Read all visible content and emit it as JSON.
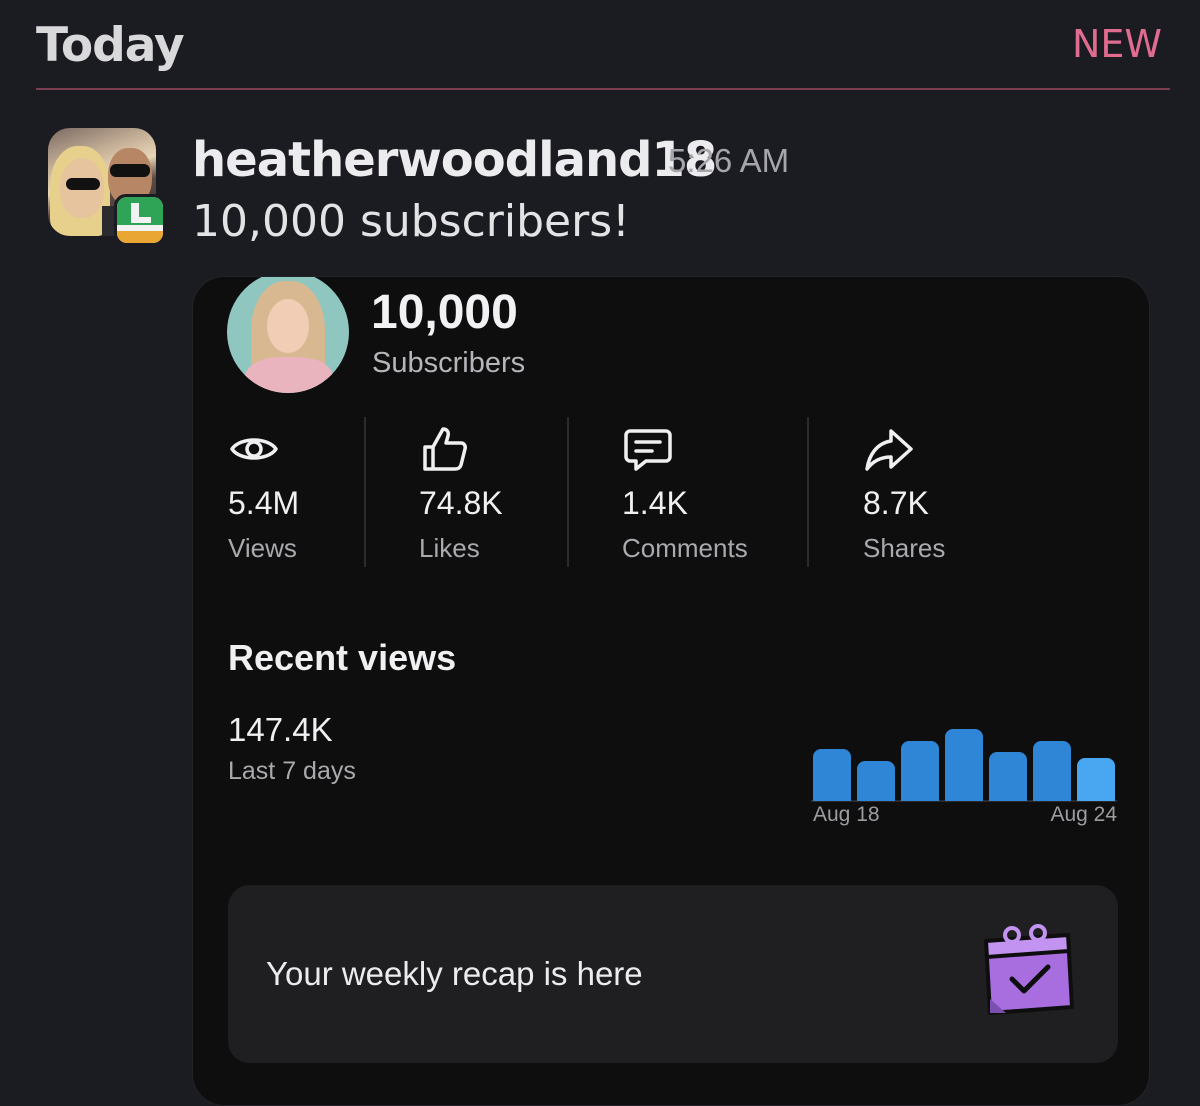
{
  "header": {
    "title": "Today",
    "new_label": "NEW"
  },
  "notification": {
    "username": "heatherwoodland18",
    "time": "5:26 AM",
    "message": "10,000 subscribers!"
  },
  "card": {
    "subscribers_count": "10,000",
    "subscribers_label": "Subscribers",
    "stats": [
      {
        "icon": "eye-icon",
        "value": "5.4M",
        "label": "Views"
      },
      {
        "icon": "thumbs-up-icon",
        "value": "74.8K",
        "label": "Likes"
      },
      {
        "icon": "comment-icon",
        "value": "1.4K",
        "label": "Comments"
      },
      {
        "icon": "share-icon",
        "value": "8.7K",
        "label": "Shares"
      }
    ],
    "recent": {
      "title": "Recent views",
      "value": "147.4K",
      "period": "Last 7 days"
    },
    "recap_text": "Your weekly recap is here"
  },
  "chart_data": {
    "type": "bar",
    "categories": [
      "Aug 18",
      "",
      "",
      "",
      "",
      "",
      "Aug 24"
    ],
    "tick_labels": [
      "Aug 18",
      "Aug 24"
    ],
    "values": [
      0.72,
      0.55,
      0.84,
      1.0,
      0.68,
      0.84,
      0.6
    ],
    "colors": {
      "bar": "#2f86d6",
      "last_bar": "#48a7f0"
    }
  },
  "colors": {
    "background": "#1b1c21",
    "accent_new": "#e06c8f",
    "card": "#0e0e0f"
  }
}
